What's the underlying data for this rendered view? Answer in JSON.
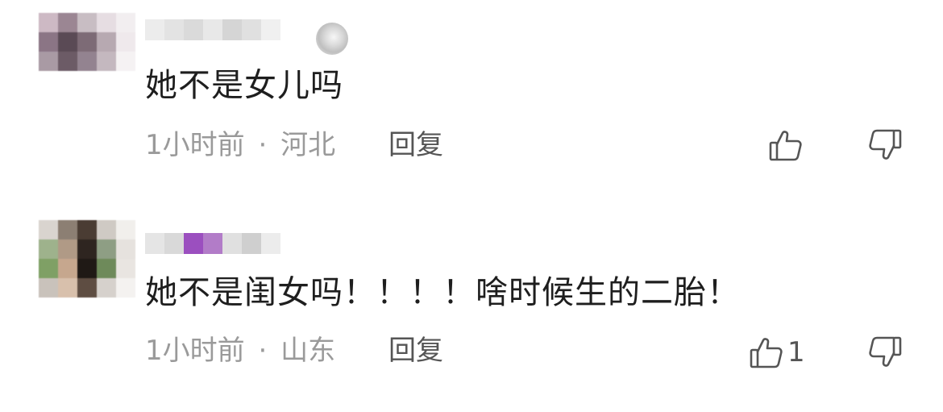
{
  "comments": [
    {
      "text": "她不是女儿吗",
      "time": "1小时前",
      "separator": "·",
      "location": "河北",
      "reply_label": "回复",
      "like_count": "",
      "avatar_colors": [
        "#cdb9c4",
        "#9b8693",
        "#c8bdc3",
        "#e6dde2",
        "#f2eef0",
        "#8b7585",
        "#5a4a55",
        "#7d6b76",
        "#b7a9b1",
        "#efe9ec",
        "#a99aa4",
        "#6c5b66",
        "#938390",
        "#c4b8bf",
        "#f5f2f3"
      ],
      "username_colors": [
        "#ececec",
        "#e3e3e3",
        "#dadada",
        "#e8e8e8",
        "#d5d5d5",
        "#e0e0e0",
        "#f0f0f0"
      ]
    },
    {
      "text": "她不是闺女吗！！！！啥时候生的二胎！",
      "time": "1小时前",
      "separator": "·",
      "location": "山东",
      "reply_label": "回复",
      "like_count": "1",
      "avatar_colors": [
        "#d9d4cf",
        "#8c7f73",
        "#4a3c33",
        "#cfcac4",
        "#f1efec",
        "#9eb28c",
        "#b09a86",
        "#2e2520",
        "#8e9e84",
        "#e6e2de",
        "#7fa065",
        "#c6a78e",
        "#1f1915",
        "#6e8a5a",
        "#e9e5e1",
        "#c9c2bb",
        "#d8c0ac",
        "#5e4d42",
        "#d6d1cc",
        "#f4f2f0"
      ],
      "username_colors": [
        "#e5e5e5",
        "#d9d9d9",
        "#9b4fbf",
        "#b27cc8",
        "#e0e0e0",
        "#cfcfcf",
        "#ececec"
      ]
    }
  ]
}
